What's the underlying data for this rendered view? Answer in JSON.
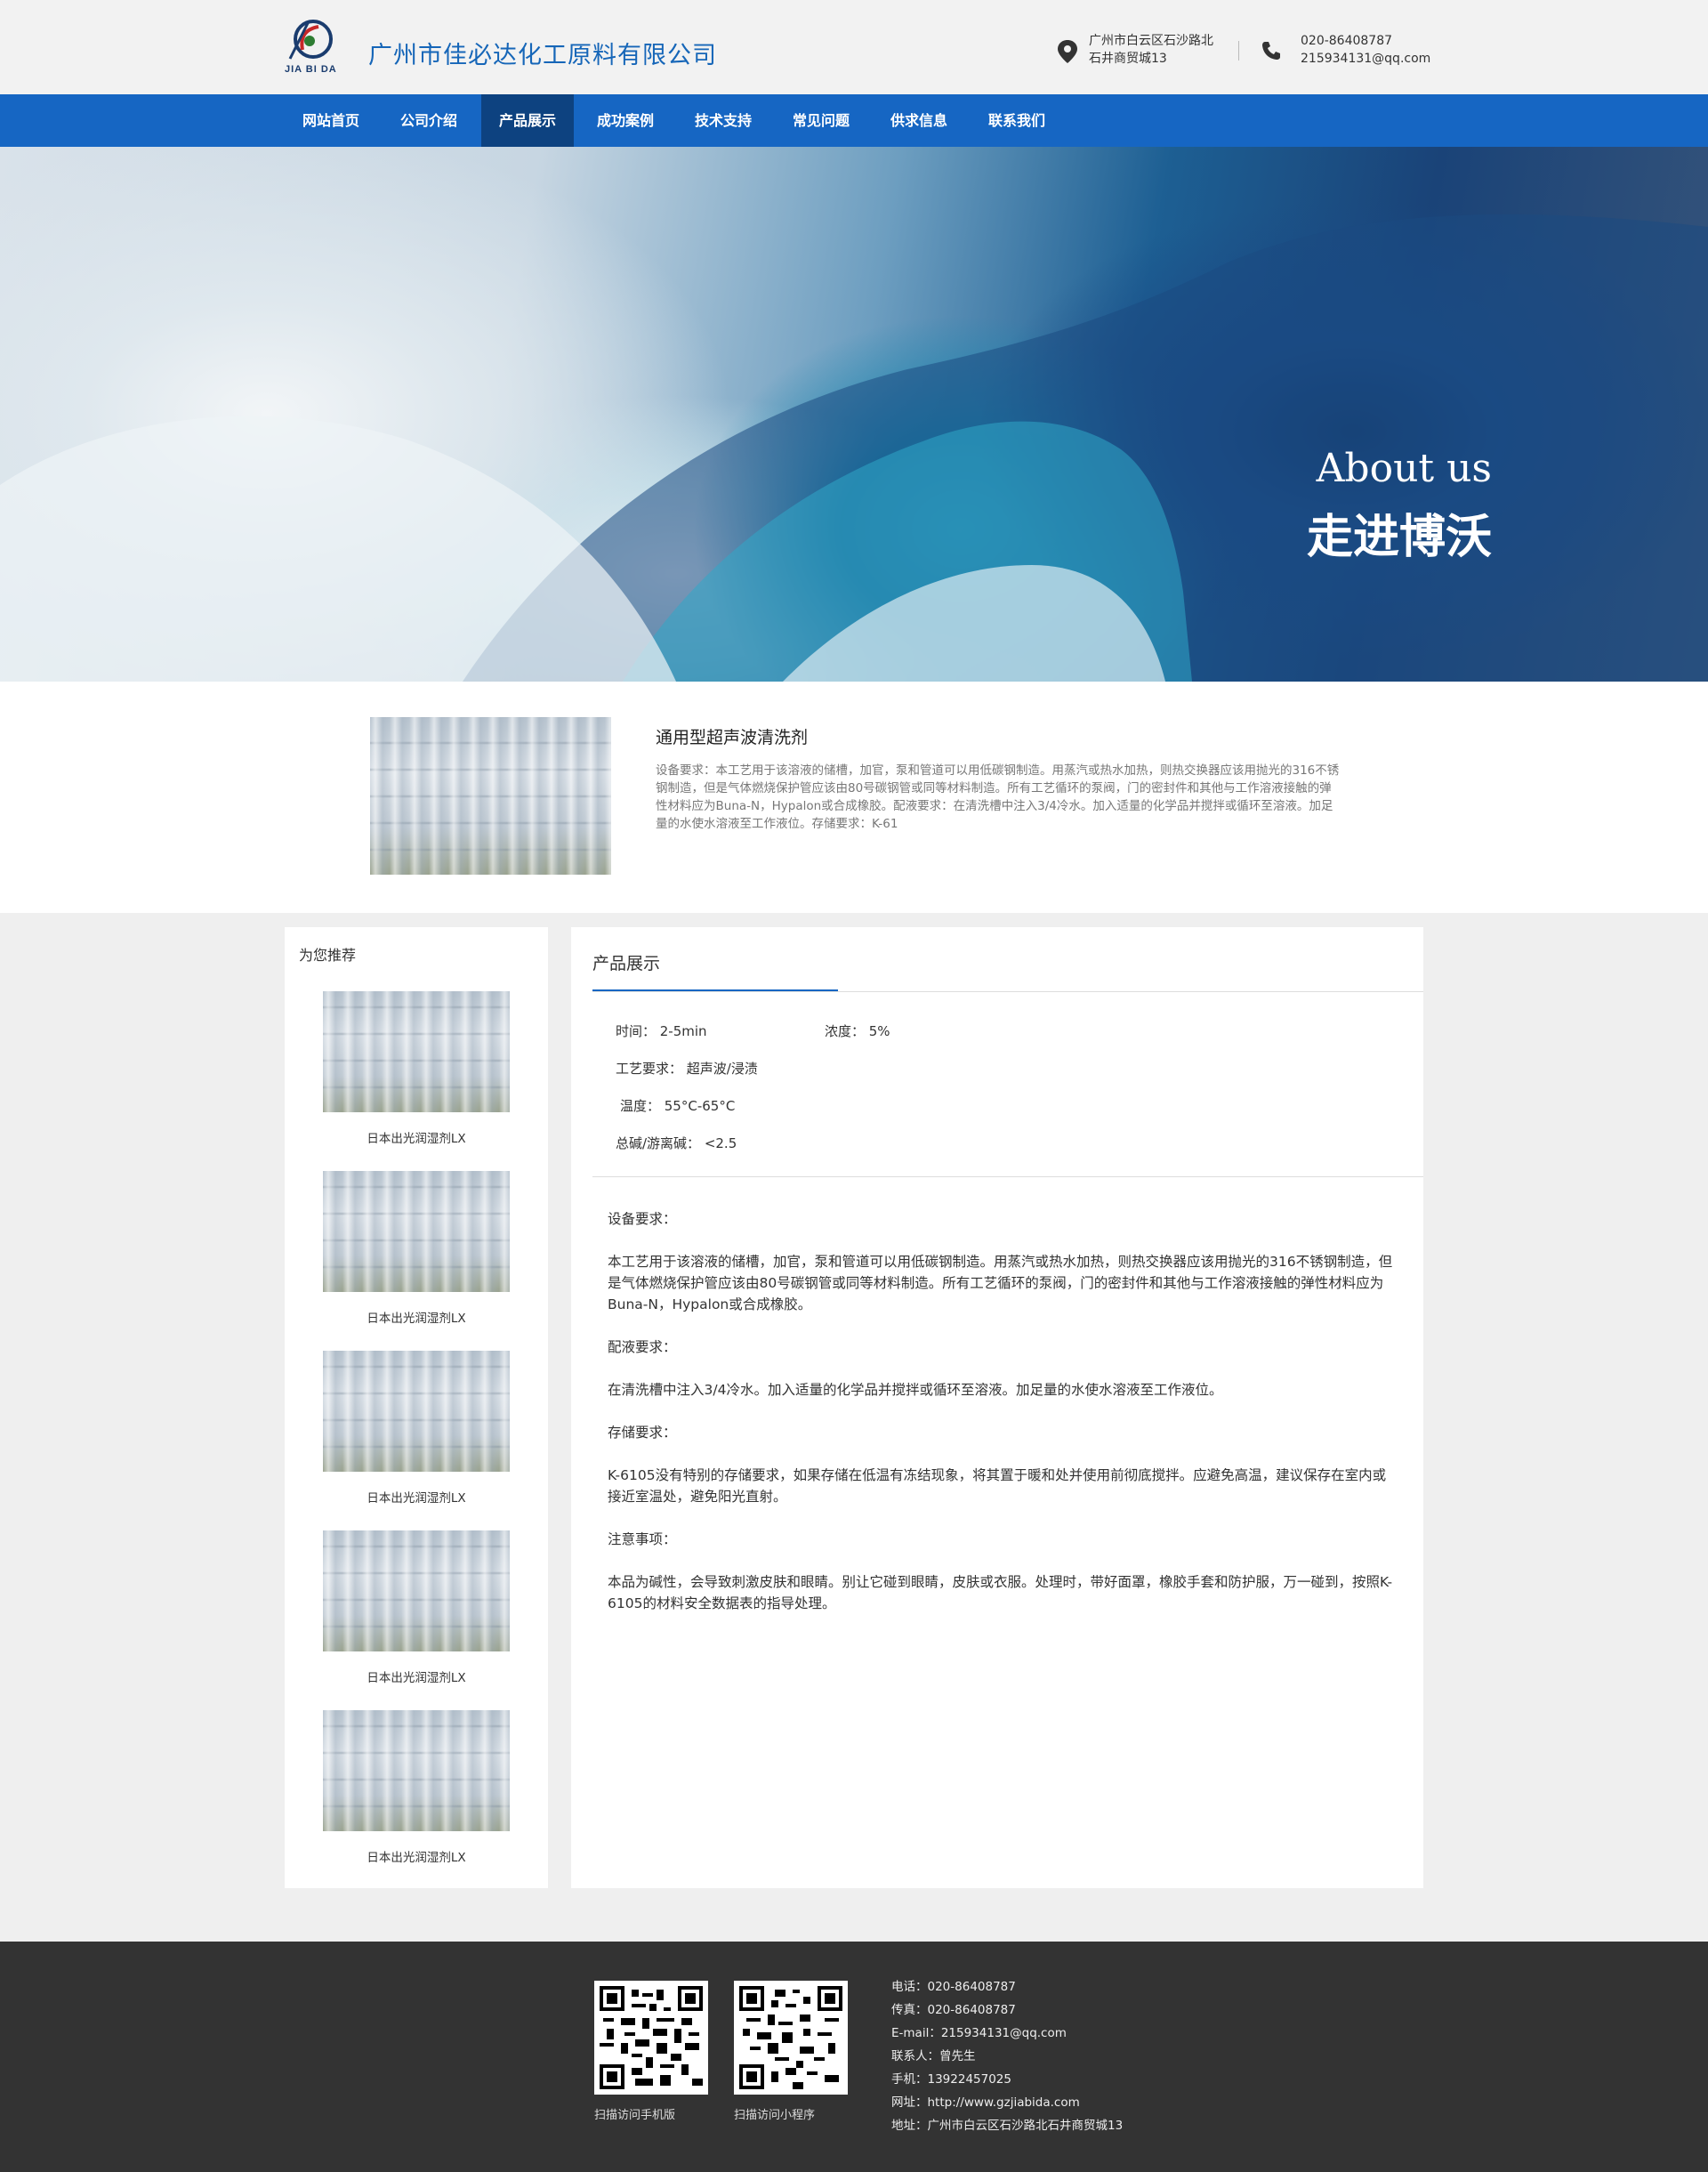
{
  "header": {
    "logo_text": "JIA BI DA",
    "company_name": "广州市佳必达化工原料有限公司",
    "address_line1": "广州市白云区石沙路北",
    "address_line2": "石井商贸城13",
    "phone": "020-86408787",
    "email": "215934131@qq.com"
  },
  "nav": {
    "items": [
      {
        "label": "网站首页"
      },
      {
        "label": "公司介绍"
      },
      {
        "label": "产品展示"
      },
      {
        "label": "成功案例"
      },
      {
        "label": "技术支持"
      },
      {
        "label": "常见问题"
      },
      {
        "label": "供求信息"
      },
      {
        "label": "联系我们"
      }
    ],
    "active_index": 2
  },
  "banner": {
    "title_en": "About us",
    "title_cn": "走进博沃"
  },
  "intro": {
    "title": "通用型超声波清洗剂",
    "desc": "设备要求：本工艺用于该溶液的储槽，加官，泵和管道可以用低碳钢制造。用蒸汽或热水加热，则热交换器应该用抛光的316不锈钢制造，但是气体燃烧保护管应该由80号碳钢管或同等材料制造。所有工艺循环的泵阀，门的密封件和其他与工作溶液接触的弹性材料应为Buna-N，Hypalon或合成橡胶。配液要求：在清洗槽中注入3/4冷水。加入适量的化学品并搅拌或循环至溶液。加足量的水使水溶液至工作液位。存储要求：K-61"
  },
  "sidebar": {
    "title": "为您推荐",
    "items": [
      {
        "label": "日本出光润湿剂LX"
      },
      {
        "label": "日本出光润湿剂LX"
      },
      {
        "label": "日本出光润湿剂LX"
      },
      {
        "label": "日本出光润湿剂LX"
      },
      {
        "label": "日本出光润湿剂LX"
      }
    ]
  },
  "main": {
    "title": "产品展示",
    "specs": {
      "time": "时间： 2-5min",
      "concentration": "浓度： 5%",
      "process": "工艺要求： 超声波/浸渍",
      "temperature": "温度： 55°C-65°C",
      "alkali": "总碱/游离碱： <2.5"
    },
    "sections": [
      {
        "heading": "设备要求：",
        "body": "本工艺用于该溶液的储槽，加官，泵和管道可以用低碳钢制造。用蒸汽或热水加热，则热交换器应该用抛光的316不锈钢制造，但是气体燃烧保护管应该由80号碳钢管或同等材料制造。所有工艺循环的泵阀，门的密封件和其他与工作溶液接触的弹性材料应为Buna-N，Hypalon或合成橡胶。"
      },
      {
        "heading": "配液要求：",
        "body": "在清洗槽中注入3/4冷水。加入适量的化学品并搅拌或循环至溶液。加足量的水使水溶液至工作液位。"
      },
      {
        "heading": "存储要求：",
        "body": "K-6105没有特别的存储要求，如果存储在低温有冻结现象，将其置于暖和处并使用前彻底搅拌。应避免高温，建议保存在室内或接近室温处，避免阳光直射。"
      },
      {
        "heading": "注意事项：",
        "body": "本品为碱性，会导致刺激皮肤和眼睛。别让它碰到眼睛，皮肤或衣服。处理时，带好面罩，橡胶手套和防护服，万一碰到，按照K-6105的材料安全数据表的指导处理。"
      }
    ]
  },
  "footer": {
    "qr1_label": "扫描访问手机版",
    "qr2_label": "扫描访问小程序",
    "info": [
      "电话：020-86408787",
      "传真：020-86408787",
      "E-mail：215934131@qq.com",
      "联系人：曾先生",
      "手机：13922457025",
      "网址：http://www.gzjiabida.com",
      "地址：广州市白云区石沙路北石井商贸城13"
    ]
  },
  "colors": {
    "brand_blue": "#1666c3",
    "nav_active": "#0d4280",
    "footer_bg": "#333333"
  },
  "icons": [
    "logo-icon",
    "location-pin-icon",
    "phone-icon",
    "qr-code-icon"
  ]
}
